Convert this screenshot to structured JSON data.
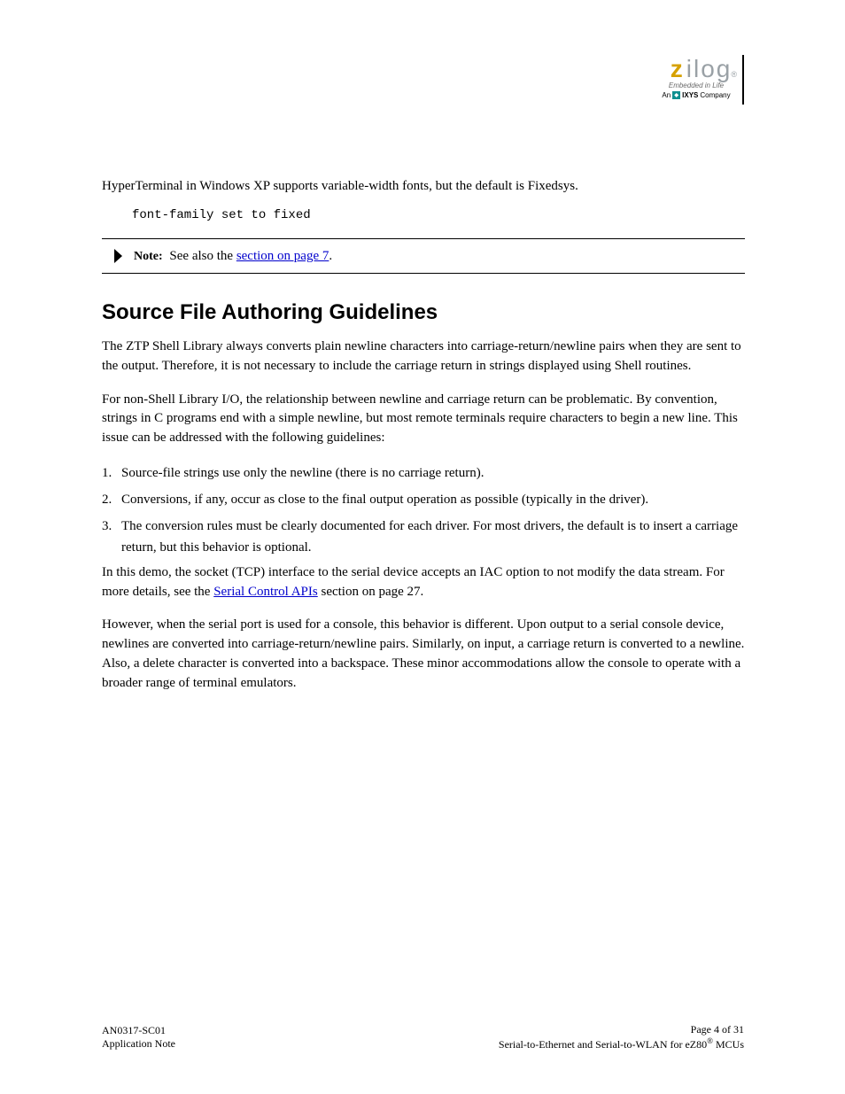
{
  "logo": {
    "z": "z",
    "rest": "ilog",
    "reg": "®",
    "tagline": "Embedded in Life",
    "company_an": "An",
    "company_ixys": "IXYS",
    "company_rest": "Company"
  },
  "intro": "HyperTerminal in Windows XP supports variable-width fonts, but the default is Fixedsys.",
  "code": "font-family set to fixed",
  "note": {
    "label": "Note:",
    "prefix": "See also the ",
    "link": "section on page 7",
    "suffix": "."
  },
  "section_title": "Source File Authoring Guidelines",
  "body": {
    "p1": "The ZTP Shell Library always converts plain newline characters into carriage-return/newline pairs when they are sent to the output. Therefore, it is not necessary to include the carriage return in strings displayed using Shell routines.",
    "p2": "For non-Shell Library I/O, the relationship between newline and carriage return can be problematic. By convention, strings in C programs end with a simple newline, but most remote terminals require characters to begin a new line. This issue can be addressed with the following guidelines:"
  },
  "list": [
    "Source-file strings use only the newline (there is no carriage return).",
    "Conversions, if any, occur as close to the final output operation as possible (typically in the driver).",
    "The conversion rules must be clearly documented for each driver. For most drivers, the default is to insert a carriage return, but this behavior is optional."
  ],
  "body_after": {
    "p3_a": "In this demo, the socket (TCP) interface to the serial device accepts an IAC option to not modify the data stream. For more details, see the ",
    "p3_link": "Serial Control APIs",
    "p3_b": " section on page 27.",
    "p4": "However, when the serial port is used for a console, this behavior is different. Upon output to a serial console device, newlines are converted into carriage-return/newline pairs. Similarly, on input, a carriage return is converted to a newline. Also, a delete character is converted into a backspace. These minor accommodations allow the console to operate with a broader range of terminal emulators."
  },
  "footer": {
    "left1": "AN0317-SC01",
    "left2": "Application Note",
    "right1": "Page 4 of 31",
    "right2_a": "Serial-to-Ethernet and Serial-to-WLAN for eZ80",
    "right2_reg": "®",
    "right2_b": " MCUs"
  }
}
